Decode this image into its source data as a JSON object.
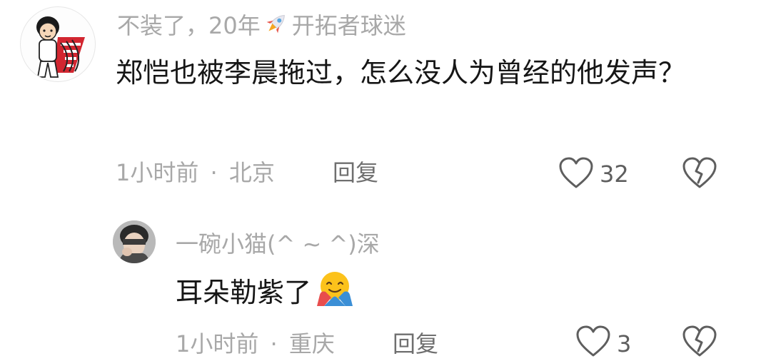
{
  "comments": [
    {
      "username_prefix": "不装了，20年",
      "badge_icon": "rocket-icon",
      "username_suffix": "开拓者球迷",
      "text": "郑恺也被李晨拖过，怎么没人为曾经的他发声？",
      "time": "1小时前",
      "separator": "·",
      "location": "北京",
      "reply_label": "回复",
      "like_count": "32"
    }
  ],
  "replies": [
    {
      "username": "一碗小猫(^ ~ ^)深",
      "text": "耳朵勒紫了",
      "emoji": "hugging-face-emoji",
      "time": "1小时前",
      "separator": "·",
      "location": "重庆",
      "reply_label": "回复",
      "like_count": "3"
    }
  ],
  "colors": {
    "text_primary": "#161616",
    "text_secondary": "#a8a8a8",
    "reply_label": "#6f6f6f",
    "icon": "#5e5e5e"
  }
}
